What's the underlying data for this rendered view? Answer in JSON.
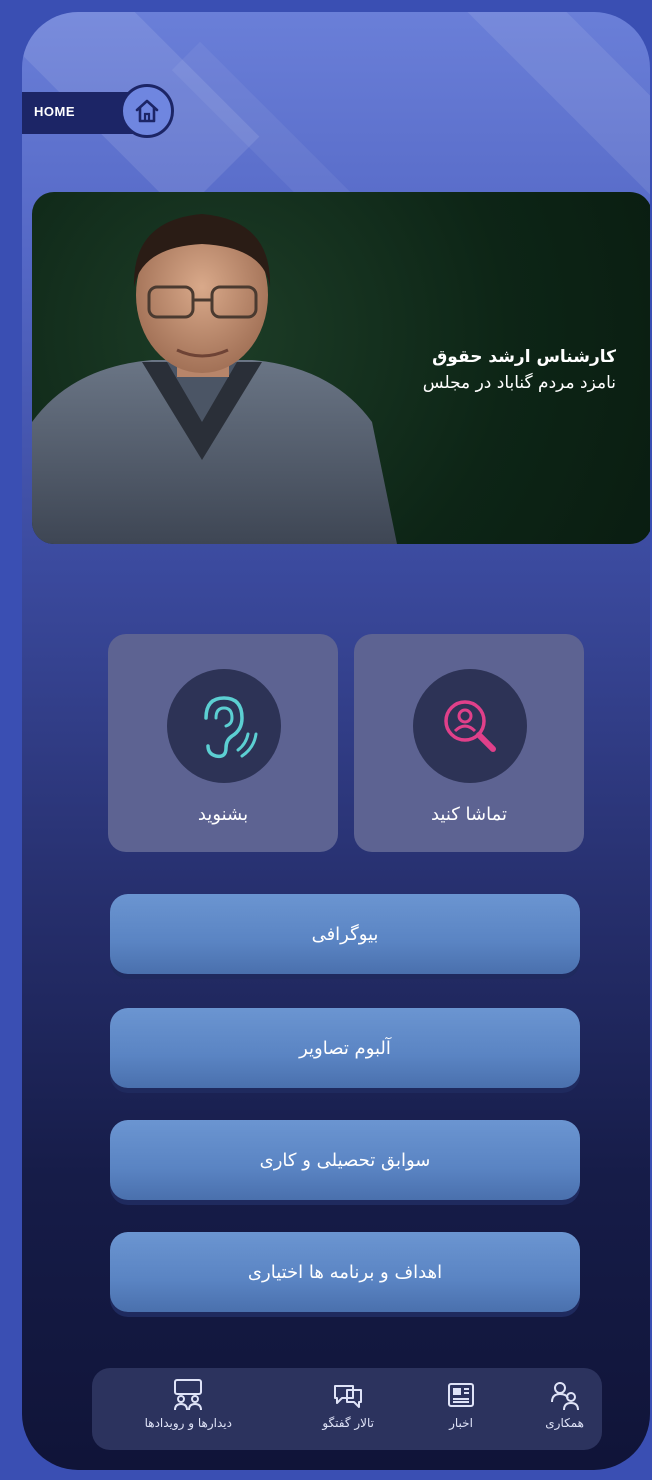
{
  "home": {
    "label": "HOME"
  },
  "hero": {
    "title": "کارشناس ارشد حقوق",
    "subtitle": "نامزد مردم گناباد در مجلس"
  },
  "tiles": [
    {
      "label": "تماشا کنید",
      "icon": "search-person-icon"
    },
    {
      "label": "بشنوید",
      "icon": "ear-icon"
    }
  ],
  "menu": [
    {
      "label": "بیوگرافی"
    },
    {
      "label": "آلبوم تصاویر"
    },
    {
      "label": "سوابق تحصیلی و کاری"
    },
    {
      "label": "اهداف و برنامه ها اختیاری"
    }
  ],
  "bottom_nav": [
    {
      "label": "همکاری",
      "icon": "people-icon"
    },
    {
      "label": "اخبار",
      "icon": "news-icon"
    },
    {
      "label": "تالار گفتگو",
      "icon": "chat-icon"
    },
    {
      "label": "دیدارها و رویدادها",
      "icon": "meeting-icon"
    }
  ],
  "colors": {
    "background": "#3a4fb3",
    "button": "#5a84c3",
    "tile": "#5d6392",
    "accent_pink": "#e0408a",
    "accent_teal": "#5ccfd2"
  }
}
